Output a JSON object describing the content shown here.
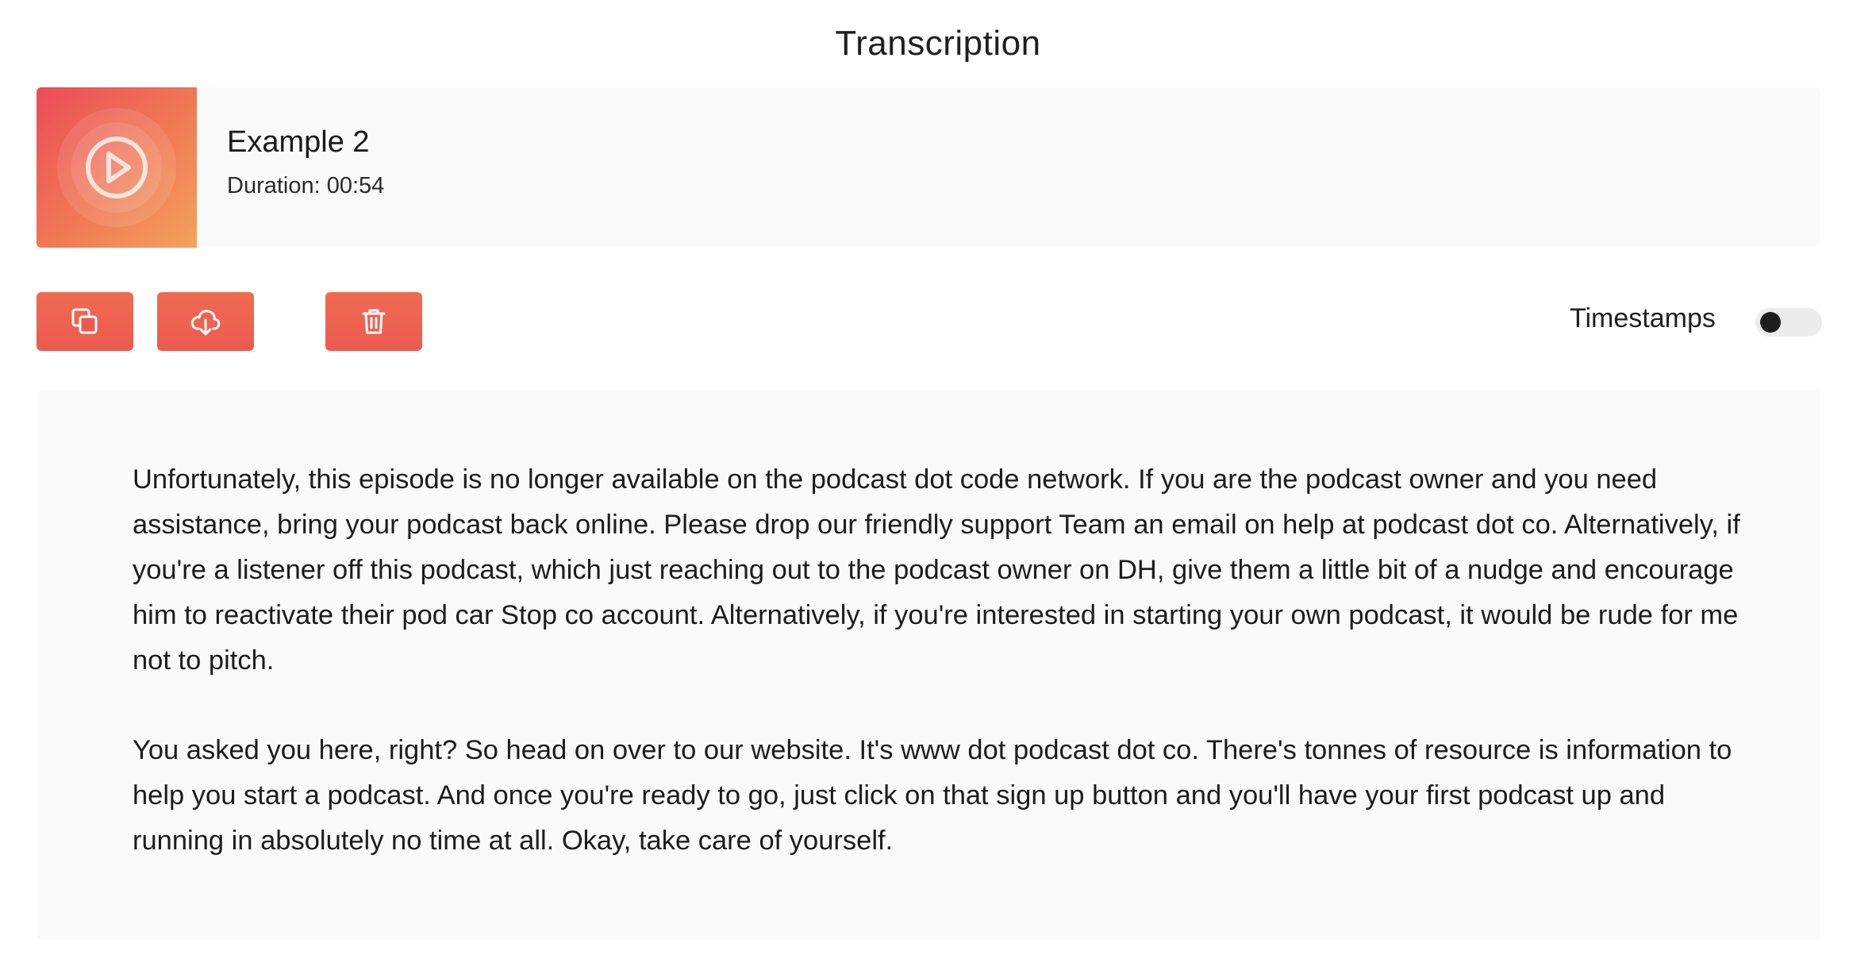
{
  "header": {
    "title": "Transcription"
  },
  "media": {
    "title": "Example 2",
    "duration": "Duration: 00:54",
    "thumbnail_icon": "play-circle-icon",
    "gradient_colors": [
      "#ec4c58",
      "#f07a55",
      "#f4a25c"
    ]
  },
  "toolbar": {
    "buttons": [
      {
        "name": "copy",
        "icon": "copy-icon"
      },
      {
        "name": "download",
        "icon": "cloud-download-icon"
      },
      {
        "name": "delete",
        "icon": "trash-icon"
      }
    ],
    "accent_color": "#ec5a4f",
    "timestamps_label": "Timestamps",
    "timestamps_enabled": false
  },
  "transcript": {
    "paragraphs": [
      "Unfortunately, this episode is no longer available on the podcast dot code network. If you are the podcast owner and you need assistance, bring your podcast back online. Please drop our friendly support Team an email on help at podcast dot co. Alternatively, if you're a listener off this podcast, which just reaching out to the podcast owner on DH, give them a little bit of a nudge and encourage him to reactivate their pod car Stop co account. Alternatively, if you're interested in starting your own podcast, it would be rude for me not to pitch.",
      "You asked you here, right? So head on over to our website. It's www dot podcast dot co. There's tonnes of resource is information to help you start a podcast. And once you're ready to go, just click on that sign up button and you'll have your first podcast up and running in absolutely no time at all. Okay, take care of yourself."
    ]
  }
}
